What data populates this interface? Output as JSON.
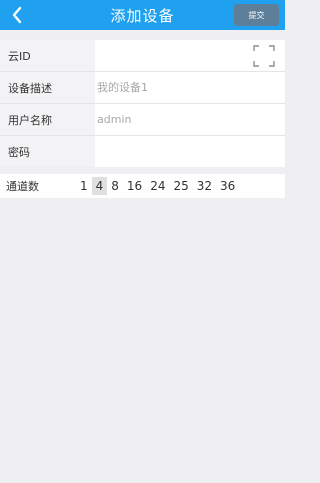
{
  "header": {
    "title": "添加设备",
    "submit_label": "提交"
  },
  "form": {
    "rows": [
      {
        "label": "云ID",
        "value": "",
        "placeholder": ""
      },
      {
        "label": "设备描述",
        "value": "",
        "placeholder": "我的设备1"
      },
      {
        "label": "用户名称",
        "value": "",
        "placeholder": "admin"
      },
      {
        "label": "密码",
        "value": "",
        "placeholder": ""
      }
    ]
  },
  "channels": {
    "label": "通道数",
    "options": [
      "1",
      "4",
      "8",
      "16",
      "24",
      "25",
      "32",
      "36"
    ],
    "selected": "4"
  },
  "colors": {
    "header_bg": "#1fa1ef",
    "submit_bg": "#5e7f9a",
    "page_bg": "#efeff2",
    "label_bg": "#f3f3f5",
    "selected_bg": "#e0e0e0"
  },
  "icons": {
    "back": "chevron-left-icon",
    "scan": "scan-frame-icon"
  }
}
